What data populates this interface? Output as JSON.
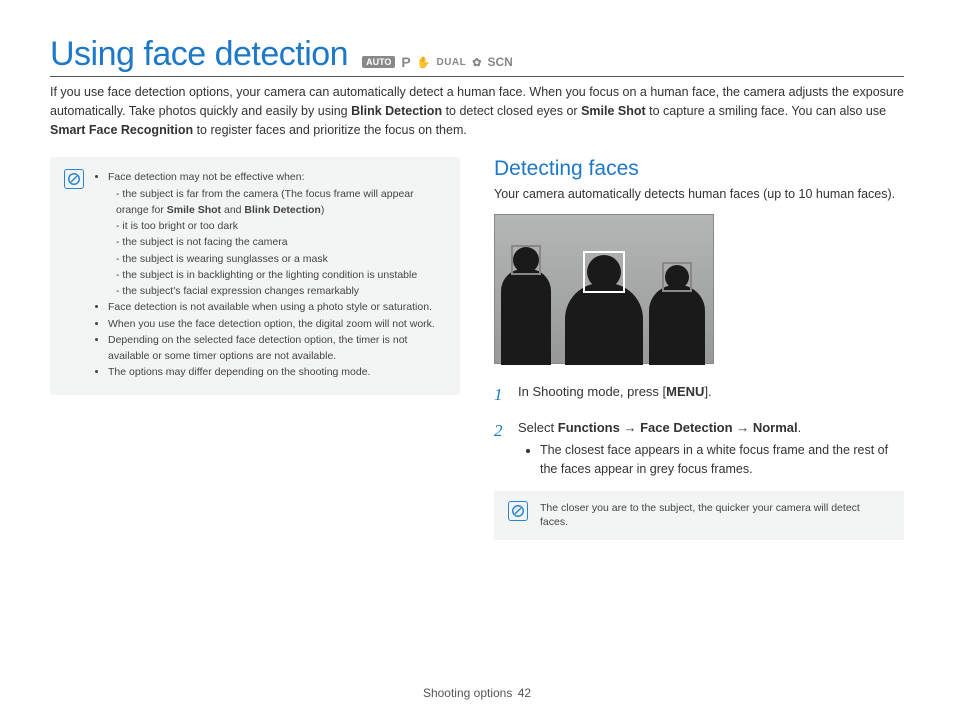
{
  "title": "Using face detection",
  "modes": {
    "auto": "AUTO",
    "p": "P",
    "dual": "DUAL",
    "scn": "SCN"
  },
  "intro": {
    "t1": "If you use face detection options, your camera can automatically detect a human face. When you focus on a human face, the camera adjusts the exposure automatically. Take photos quickly and easily by using ",
    "b1": "Blink Detection",
    "t2": " to detect closed eyes or ",
    "b2": "Smile Shot",
    "t3": " to capture a smiling face. You can also use ",
    "b3": "Smart Face Recognition",
    "t4": " to register faces and prioritize the focus on them."
  },
  "notes": {
    "lead": "Face detection may not be effective when:",
    "sub1a": "the subject is far from the camera (The focus frame will appear orange for ",
    "sub1b": "Smile Shot",
    "sub1c": " and ",
    "sub1d": "Blink Detection",
    "sub1e": ")",
    "sub2": "it is too bright or too dark",
    "sub3": "the subject is not facing the camera",
    "sub4": "the subject is wearing sunglasses or a mask",
    "sub5": "the subject is in backlighting or the lighting condition is unstable",
    "sub6": "the subject's facial expression changes remarkably",
    "b2": "Face detection is not available when using a photo style or saturation.",
    "b3": "When you use the face detection option, the digital zoom will not work.",
    "b4": "Depending on the selected face detection option, the timer is not available or some timer options are not available.",
    "b5": "The options may differ depending on the shooting mode."
  },
  "section": {
    "head": "Detecting faces",
    "desc": "Your camera automatically detects human faces (up to 10 human faces)."
  },
  "steps": {
    "s1a": "In Shooting mode, press [",
    "s1b": "MENU",
    "s1c": "].",
    "s2a": "Select ",
    "s2b": "Functions",
    "s2arr1": " → ",
    "s2c": "Face Detection",
    "s2arr2": " → ",
    "s2d": "Normal",
    "s2e": ".",
    "s2bullet": "The closest face appears in a white focus frame and the rest of the faces appear in grey focus frames."
  },
  "tip": "The closer you are to the subject, the quicker your camera will detect faces.",
  "footer": {
    "section": "Shooting options",
    "page": "42"
  }
}
